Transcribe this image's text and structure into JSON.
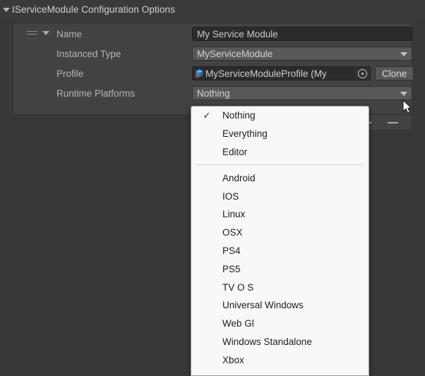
{
  "header": {
    "title": "IServiceModule Configuration Options",
    "foldout_icon": "triangle-down-icon"
  },
  "list": {
    "drag_handle_icon": "drag-handle-icon",
    "row_foldout_icon": "triangle-down-icon",
    "rows": [
      {
        "label": "Name",
        "type": "text",
        "value": "My Service Module"
      },
      {
        "label": "Instanced Type",
        "type": "popup",
        "value": "MyServiceModule"
      },
      {
        "label": "Profile",
        "type": "object",
        "value": "MyServiceModuleProfile (My",
        "object_icon": "scriptable-object-icon",
        "picker_icon": "object-picker-icon",
        "button_label": "Clone"
      },
      {
        "label": "Runtime Platforms",
        "type": "popup",
        "value": "Nothing"
      }
    ],
    "footer": {
      "add_label": "+",
      "remove_label": "−",
      "add_icon": "plus-icon",
      "remove_icon": "minus-icon"
    }
  },
  "dropdown": {
    "check_glyph": "✓",
    "groups": [
      {
        "items": [
          {
            "label": "Nothing",
            "checked": true
          },
          {
            "label": "Everything",
            "checked": false
          },
          {
            "label": "Editor",
            "checked": false
          }
        ]
      },
      {
        "items": [
          {
            "label": "Android",
            "checked": false
          },
          {
            "label": "IOS",
            "checked": false
          },
          {
            "label": "Linux",
            "checked": false
          },
          {
            "label": "OSX",
            "checked": false
          },
          {
            "label": "PS4",
            "checked": false
          },
          {
            "label": "PS5",
            "checked": false
          },
          {
            "label": "TV O S",
            "checked": false
          },
          {
            "label": "Universal Windows",
            "checked": false
          },
          {
            "label": "Web Gl",
            "checked": false
          },
          {
            "label": "Windows Standalone",
            "checked": false
          },
          {
            "label": "Xbox",
            "checked": false
          }
        ]
      }
    ]
  },
  "cursor": {
    "icon": "mouse-pointer-icon"
  },
  "colors": {
    "background": "#383838",
    "panel": "#424242",
    "text_field": "#2b2b2b",
    "popup_field": "#585858",
    "dropdown_background": "#f8f8f8",
    "label_text": "#b4b4b4",
    "accent_icon_blue": "#3b9ad9",
    "accent_icon_orange": "#e8622a"
  }
}
